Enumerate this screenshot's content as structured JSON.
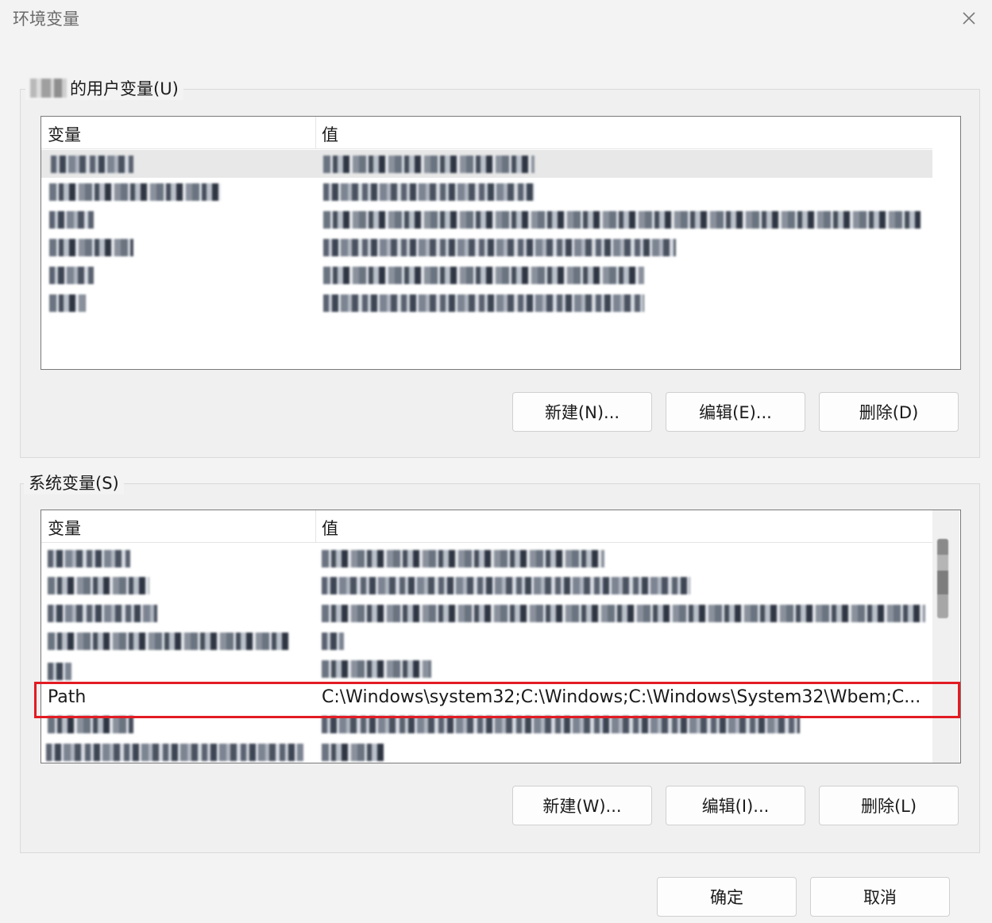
{
  "window": {
    "title": "环境变量"
  },
  "user_vars": {
    "group_label": "的用户变量(U)",
    "columns": {
      "variable": "变量",
      "value": "值"
    },
    "rows_count": 6,
    "buttons": {
      "new": "新建(N)...",
      "edit": "编辑(E)...",
      "delete": "删除(D)"
    }
  },
  "system_vars": {
    "group_label": "系统变量(S)",
    "columns": {
      "variable": "变量",
      "value": "值"
    },
    "path_row": {
      "variable": "Path",
      "value": "C:\\Windows\\system32;C:\\Windows;C:\\Windows\\System32\\Wbem;C..."
    },
    "buttons": {
      "new": "新建(W)...",
      "edit": "编辑(I)...",
      "delete": "删除(L)"
    }
  },
  "footer": {
    "ok": "确定",
    "cancel": "取消"
  },
  "colors": {
    "highlight": "#e21b23",
    "dialog_bg": "#f3f3f3"
  }
}
